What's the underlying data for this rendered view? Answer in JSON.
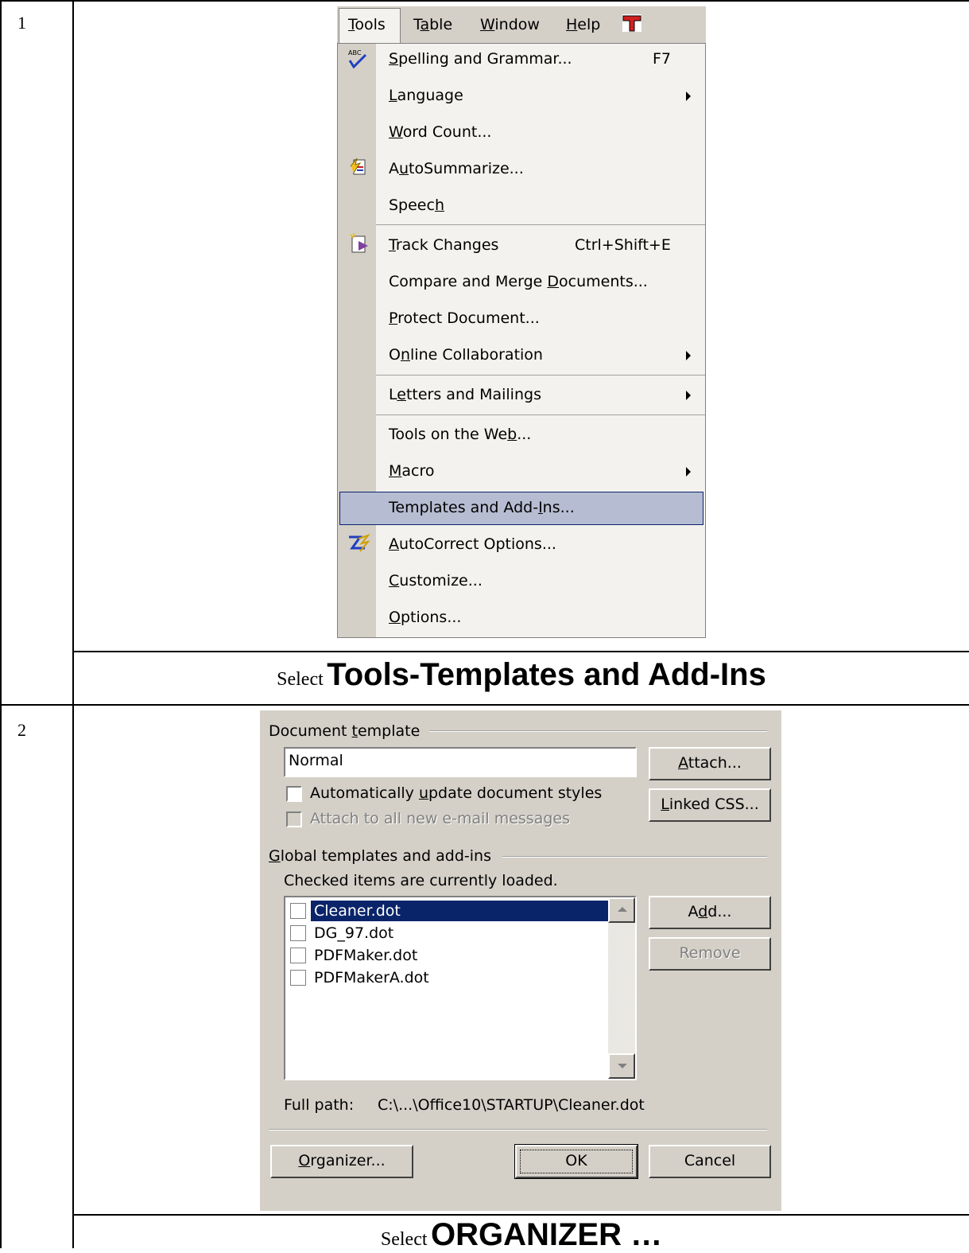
{
  "steps": [
    {
      "number": "1",
      "caption_prefix": "Select",
      "caption_main": "Tools-Templates and Add-Ins"
    },
    {
      "number": "2",
      "caption_prefix": "Select",
      "caption_main": "ORGANIZER …"
    }
  ],
  "menubar": {
    "items": [
      "Tools",
      "Table",
      "Window",
      "Help"
    ],
    "logo_icon": "red-t-icon"
  },
  "menu": {
    "items": [
      {
        "label": "Spelling and Grammar...",
        "shortcut": "F7",
        "icon": "spelling-abc-icon"
      },
      {
        "label": "Language",
        "submenu": true
      },
      {
        "label": "Word Count..."
      },
      {
        "label": "AutoSummarize...",
        "icon": "autosummarize-icon"
      },
      {
        "label": "Speech"
      },
      {
        "label": "Track Changes",
        "shortcut": "Ctrl+Shift+E",
        "icon": "track-changes-icon"
      },
      {
        "label": "Compare and Merge Documents..."
      },
      {
        "label": "Protect Document..."
      },
      {
        "label": "Online Collaboration",
        "submenu": true
      },
      {
        "label": "Letters and Mailings",
        "submenu": true
      },
      {
        "label": "Tools on the Web..."
      },
      {
        "label": "Macro",
        "submenu": true
      },
      {
        "label": "Templates and Add-Ins...",
        "highlighted": true
      },
      {
        "label": "AutoCorrect Options...",
        "icon": "autocorrect-icon"
      },
      {
        "label": "Customize..."
      },
      {
        "label": "Options..."
      }
    ],
    "highlight_color": "#b6bdd2"
  },
  "dialog": {
    "doc_template_label": "Document template",
    "doc_template_value": "Normal",
    "attach_button": "Attach...",
    "linked_css_button": "Linked CSS...",
    "auto_update_label": "Automatically update document styles",
    "auto_update_checked": false,
    "attach_email_label": "Attach to all new e-mail messages",
    "global_label": "Global templates and add-ins",
    "checked_note": "Checked items are currently loaded.",
    "templates": [
      {
        "name": "Cleaner.dot",
        "checked": false,
        "selected": true
      },
      {
        "name": "DG_97.dot",
        "checked": false
      },
      {
        "name": "PDFMaker.dot",
        "checked": false
      },
      {
        "name": "PDFMakerA.dot",
        "checked": false
      }
    ],
    "add_button": "Add...",
    "remove_button": "Remove",
    "full_path_label": "Full path:",
    "full_path_value": "C:\\...\\Office10\\STARTUP\\Cleaner.dot",
    "organizer_button": "Organizer...",
    "ok_button": "OK",
    "cancel_button": "Cancel",
    "selection_color": "#0a246a"
  }
}
